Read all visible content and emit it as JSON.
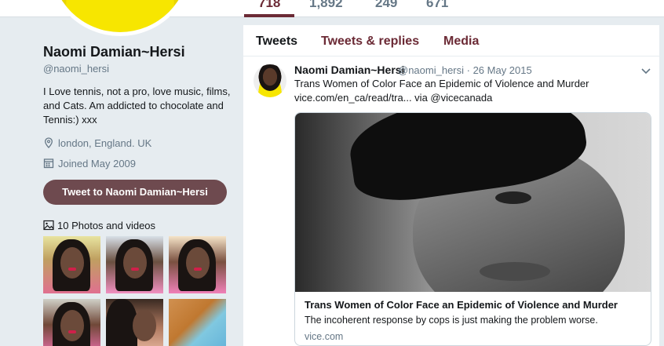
{
  "stats": {
    "tweets": "718",
    "following": "1,892",
    "followers": "249",
    "likes": "671"
  },
  "profile": {
    "name": "Naomi Damian~Hersi",
    "handle": "@naomi_hersi",
    "bio": "I Love tennis, not a pro, love music, films, and Cats. Am addicted to chocolate and Tennis:) xxx",
    "location": "london, England. UK",
    "joined": "Joined May 2009",
    "tweet_to_label": "Tweet to Naomi Damian~Hersi",
    "photos_label": "10 Photos and videos"
  },
  "tabs": [
    {
      "label": "Tweets"
    },
    {
      "label": "Tweets & replies"
    },
    {
      "label": "Media"
    }
  ],
  "tweet": {
    "name": "Naomi Damian~Hersi",
    "handle_date": "@naomi_hersi · 26 May 2015",
    "text": "Trans Women of Color Face an Epidemic of Violence and Murder",
    "link": "vice.com/en_ca/read/tra... via @vicecanada",
    "card": {
      "title": "Trans Women of Color Face an Epidemic of Violence and Murder",
      "description": "The incoherent response by cops is just making the problem worse.",
      "domain": "vice.com"
    }
  },
  "colors": {
    "accent": "#6b2a35",
    "button": "#6e4a4f",
    "background": "#e6ecf0"
  },
  "icons": [
    "location-icon",
    "calendar-icon",
    "photo-icon",
    "chevron-down-icon"
  ]
}
